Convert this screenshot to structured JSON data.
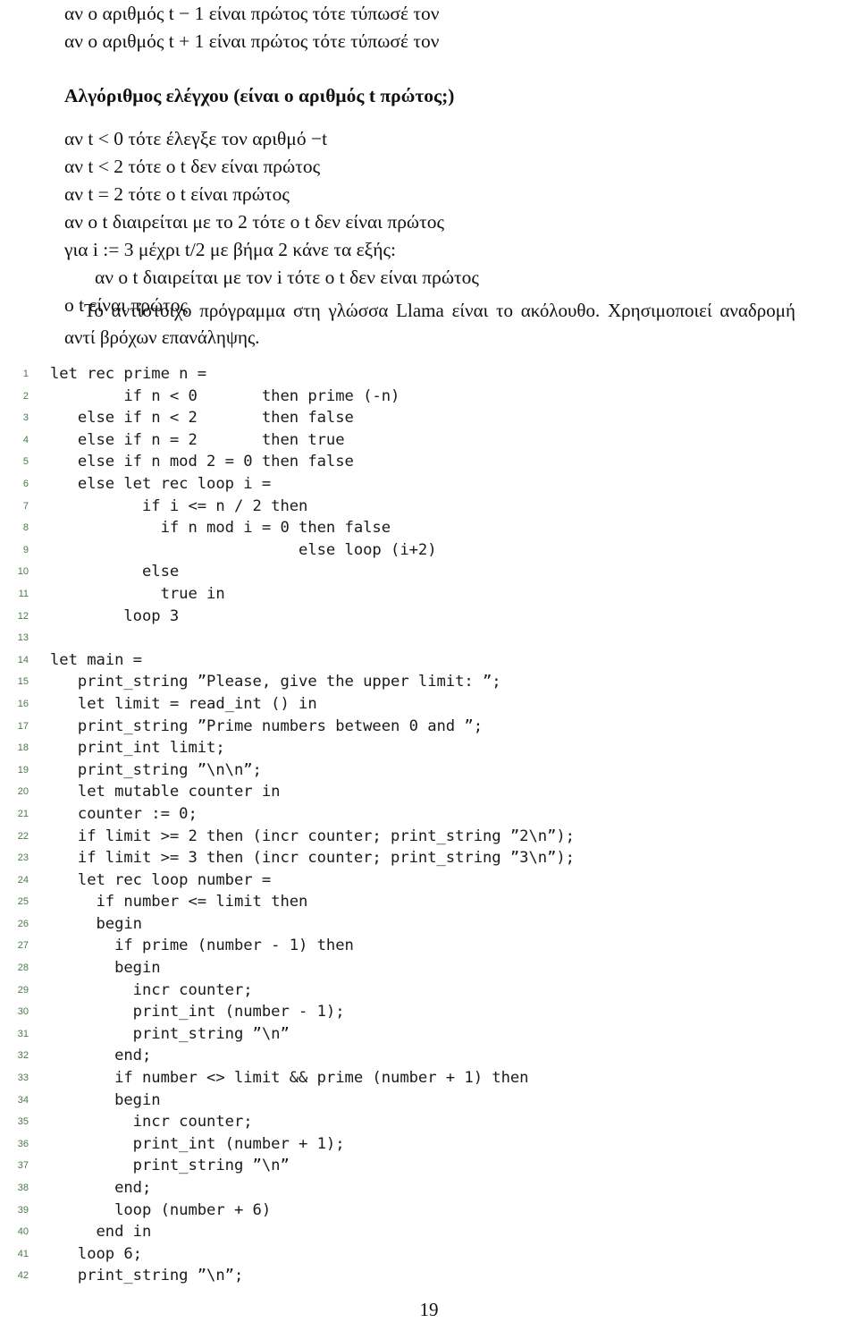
{
  "document": {
    "page_number": "19"
  },
  "pseudocode_intro": [
    {
      "id": "intro-1",
      "text": "αν ο αριθμός t − 1 είναι πρώτος τότε τύπωσέ τον"
    },
    {
      "id": "intro-2",
      "text": "αν ο αριθμός t + 1 είναι πρώτος τότε τύπωσέ τον"
    }
  ],
  "algorithm": {
    "heading": "Αλγόριθμος ελέγχου (είναι ο αριθμός t πρώτος;)",
    "steps": [
      {
        "id": "step-1",
        "text": "αν t < 0 τότε έλεγξε τον αριθμό −t",
        "indent": 0
      },
      {
        "id": "step-2",
        "text": "αν t < 2 τότε ο t δεν είναι πρώτος",
        "indent": 0
      },
      {
        "id": "step-3",
        "text": "αν t = 2 τότε ο t είναι πρώτος",
        "indent": 0
      },
      {
        "id": "step-4",
        "text": "αν ο t διαιρείται με το 2 τότε ο t δεν είναι πρώτος",
        "indent": 0
      },
      {
        "id": "step-5",
        "text": "για i := 3 μέχρι t/2 με βήμα 2 κάνε τα εξής:",
        "indent": 0
      },
      {
        "id": "step-6",
        "text": "αν ο t διαιρείται με τον i τότε ο t δεν είναι πρώτος",
        "indent": 1
      },
      {
        "id": "step-7",
        "text": "ο t είναι πρώτος",
        "indent": 0
      }
    ]
  },
  "paragraph": {
    "text": "Το αντίστοιχο πρόγραμμα στη γλώσσα Llama είναι το ακόλουθο. Χρησιμοποιεί αναδρομή αντί βρόχων επανάληψης."
  },
  "listing": {
    "language": "Llama",
    "lineno_color": "#4c7a4c",
    "lines": [
      {
        "n": "1",
        "code": "let rec prime n ="
      },
      {
        "n": "2",
        "code": "        if n < 0       then prime (-n)"
      },
      {
        "n": "3",
        "code": "   else if n < 2       then false"
      },
      {
        "n": "4",
        "code": "   else if n = 2       then true"
      },
      {
        "n": "5",
        "code": "   else if n mod 2 = 0 then false"
      },
      {
        "n": "6",
        "code": "   else let rec loop i ="
      },
      {
        "n": "7",
        "code": "          if i <= n / 2 then"
      },
      {
        "n": "8",
        "code": "            if n mod i = 0 then false"
      },
      {
        "n": "9",
        "code": "                           else loop (i+2)"
      },
      {
        "n": "10",
        "code": "          else"
      },
      {
        "n": "11",
        "code": "            true in"
      },
      {
        "n": "12",
        "code": "        loop 3"
      },
      {
        "n": "13",
        "code": ""
      },
      {
        "n": "14",
        "code": "let main ="
      },
      {
        "n": "15",
        "code": "   print_string ”Please, give the upper limit: ”;"
      },
      {
        "n": "16",
        "code": "   let limit = read_int () in"
      },
      {
        "n": "17",
        "code": "   print_string ”Prime numbers between 0 and ”;"
      },
      {
        "n": "18",
        "code": "   print_int limit;"
      },
      {
        "n": "19",
        "code": "   print_string ”\\n\\n”;"
      },
      {
        "n": "20",
        "code": "   let mutable counter in"
      },
      {
        "n": "21",
        "code": "   counter := 0;"
      },
      {
        "n": "22",
        "code": "   if limit >= 2 then (incr counter; print_string ”2\\n”);"
      },
      {
        "n": "23",
        "code": "   if limit >= 3 then (incr counter; print_string ”3\\n”);"
      },
      {
        "n": "24",
        "code": "   let rec loop number ="
      },
      {
        "n": "25",
        "code": "     if number <= limit then"
      },
      {
        "n": "26",
        "code": "     begin"
      },
      {
        "n": "27",
        "code": "       if prime (number - 1) then"
      },
      {
        "n": "28",
        "code": "       begin"
      },
      {
        "n": "29",
        "code": "         incr counter;"
      },
      {
        "n": "30",
        "code": "         print_int (number - 1);"
      },
      {
        "n": "31",
        "code": "         print_string ”\\n”"
      },
      {
        "n": "32",
        "code": "       end;"
      },
      {
        "n": "33",
        "code": "       if number <> limit && prime (number + 1) then"
      },
      {
        "n": "34",
        "code": "       begin"
      },
      {
        "n": "35",
        "code": "         incr counter;"
      },
      {
        "n": "36",
        "code": "         print_int (number + 1);"
      },
      {
        "n": "37",
        "code": "         print_string ”\\n”"
      },
      {
        "n": "38",
        "code": "       end;"
      },
      {
        "n": "39",
        "code": "       loop (number + 6)"
      },
      {
        "n": "40",
        "code": "     end in"
      },
      {
        "n": "41",
        "code": "   loop 6;"
      },
      {
        "n": "42",
        "code": "   print_string ”\\n”;"
      }
    ]
  }
}
